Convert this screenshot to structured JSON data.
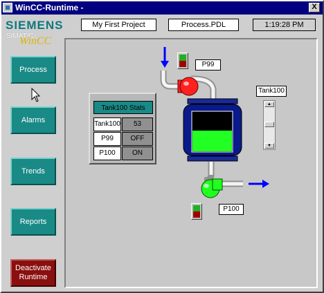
{
  "window": {
    "title": "WinCC-Runtime -",
    "close_label": "X"
  },
  "branding": {
    "company": "SIEMENS",
    "product_line": "SIMATIC",
    "product": "WinCC"
  },
  "header": {
    "project": "My First Project",
    "picture": "Process.PDL",
    "clock": "1:19:28 PM"
  },
  "nav": {
    "process": "Process",
    "alarms": "Alarms",
    "trends": "Trends",
    "reports": "Reports",
    "deactivate_line1": "Deactivate",
    "deactivate_line2": "Runtime"
  },
  "stats": {
    "title": "Tank100 Stats",
    "rows": [
      {
        "label": "Tank100",
        "value": "53"
      },
      {
        "label": "P99",
        "value": "OFF"
      },
      {
        "label": "P100",
        "value": "ON"
      }
    ]
  },
  "tags": {
    "p99": "P99",
    "p100": "P100",
    "tank100": "Tank100"
  },
  "process": {
    "tank_level_percent": 53,
    "slider_level_percent": 53,
    "pump_p99_state": "OFF",
    "pump_p100_state": "ON",
    "colors": {
      "pump_off": "#ff2020",
      "pump_on": "#20ff20",
      "tank_body": "#0a1a8a",
      "tank_fill": "#22ff22",
      "flow_arrow": "#0000ff",
      "nav_button": "#1a8a86",
      "deactivate_button": "#8a0f0f"
    }
  }
}
